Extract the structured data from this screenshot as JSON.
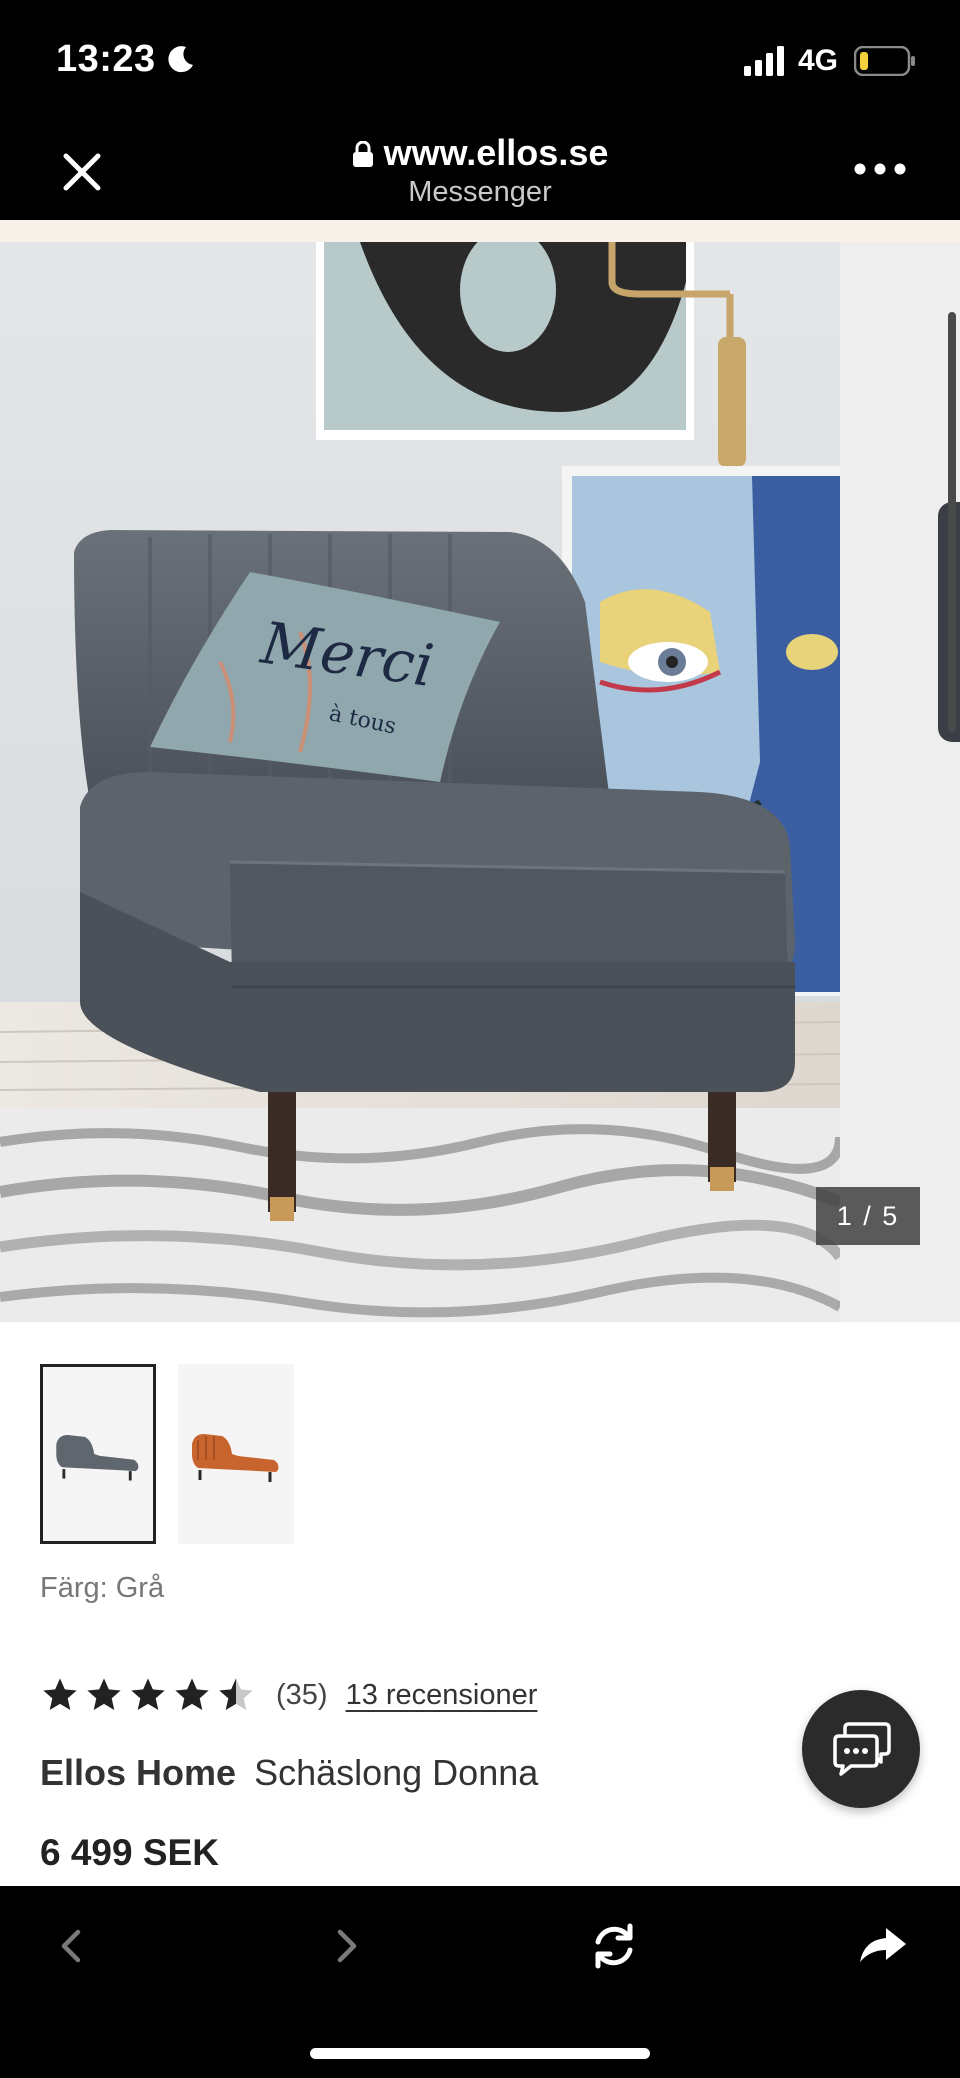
{
  "status_bar": {
    "time": "13:23",
    "network": "4G",
    "icons": [
      "moon-icon",
      "signal-icon",
      "battery-icon"
    ]
  },
  "browser": {
    "url": "www.ellos.se",
    "app": "Messenger",
    "icons": [
      "close-icon",
      "lock-icon",
      "more-icon"
    ]
  },
  "gallery": {
    "counter": "1 / 5",
    "artwork_text": [
      "Merci",
      "à tous"
    ]
  },
  "thumbnails": [
    {
      "color": "Grå",
      "selected": true
    },
    {
      "color": "orange",
      "selected": false
    }
  ],
  "product": {
    "color_label": "Färg: Grå",
    "rating": 4.5,
    "rating_count": "(35)",
    "reviews_link": "13 recensioner",
    "brand": "Ellos Home",
    "name": "Schäslong Donna",
    "price": "6 499 SEK"
  },
  "toolbar": {
    "icons": [
      "back-icon",
      "forward-icon",
      "reload-icon",
      "share-icon"
    ]
  },
  "colors": {
    "bar_bg": "#000000",
    "sofa": "#5b626b",
    "accent_text": "#222222",
    "fab": "#2b2b2b"
  }
}
